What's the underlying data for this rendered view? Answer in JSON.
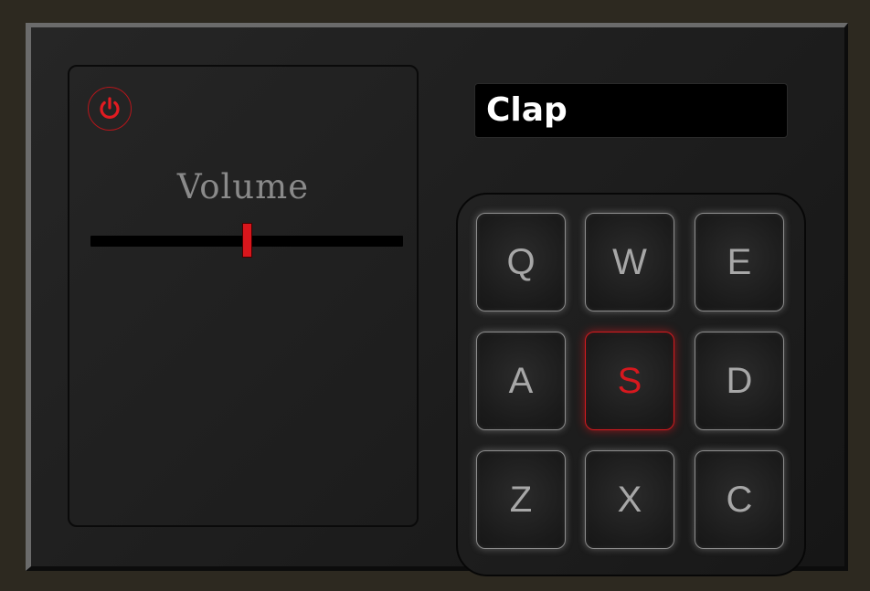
{
  "colors": {
    "accent": "#d9161c",
    "pad_text": "#a7a7a7",
    "display_bg": "#000000",
    "display_text": "#ffffff",
    "label_text": "#8a8a8a"
  },
  "controls": {
    "power_icon": "power-icon",
    "power_on": true,
    "volume_label": "Volume",
    "volume_level": 0.5
  },
  "display": {
    "text": "Clap"
  },
  "pads": [
    {
      "key": "Q",
      "active": false
    },
    {
      "key": "W",
      "active": false
    },
    {
      "key": "E",
      "active": false
    },
    {
      "key": "A",
      "active": false
    },
    {
      "key": "S",
      "active": true
    },
    {
      "key": "D",
      "active": false
    },
    {
      "key": "Z",
      "active": false
    },
    {
      "key": "X",
      "active": false
    },
    {
      "key": "C",
      "active": false
    }
  ]
}
